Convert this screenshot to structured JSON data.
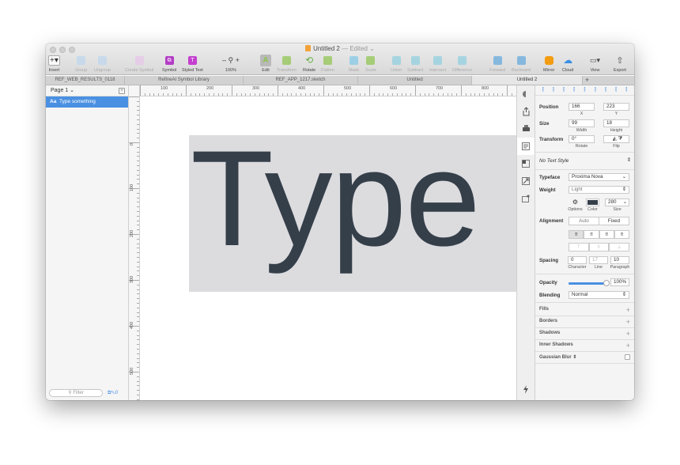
{
  "window": {
    "title": "Untitled 2",
    "title_suffix": "— Edited",
    "doc_icon": "sketch-doc-icon"
  },
  "toolbar": [
    {
      "id": "insert",
      "label": "Insert",
      "icon": "plus-icon",
      "dim": false
    },
    {
      "id": "group",
      "label": "Group",
      "icon": "group-icon",
      "dim": true
    },
    {
      "id": "ungroup",
      "label": "Ungroup",
      "icon": "ungroup-icon",
      "dim": true
    },
    {
      "id": "create-symbol",
      "label": "Create Symbol",
      "icon": "create-symbol-icon",
      "dim": true
    },
    {
      "id": "symbol",
      "label": "Symbol",
      "icon": "symbol-icon",
      "dim": false
    },
    {
      "id": "styled-text",
      "label": "Styled Text",
      "icon": "styled-text-icon",
      "dim": false
    },
    {
      "id": "zoom",
      "label": "100%",
      "icon": "zoom-icon",
      "dim": false
    },
    {
      "id": "edit",
      "label": "Edit",
      "icon": "edit-text-icon",
      "dim": false
    },
    {
      "id": "transform",
      "label": "Transform",
      "icon": "transform-icon",
      "dim": true
    },
    {
      "id": "rotate",
      "label": "Rotate",
      "icon": "rotate-icon",
      "dim": false
    },
    {
      "id": "flatten",
      "label": "Flatten",
      "icon": "flatten-icon",
      "dim": true
    },
    {
      "id": "mask",
      "label": "Mask",
      "icon": "mask-icon",
      "dim": true
    },
    {
      "id": "scale",
      "label": "Scale",
      "icon": "scale-icon",
      "dim": true
    },
    {
      "id": "union",
      "label": "Union",
      "icon": "union-icon",
      "dim": true
    },
    {
      "id": "subtract",
      "label": "Subtract",
      "icon": "subtract-icon",
      "dim": true
    },
    {
      "id": "intersect",
      "label": "Intersect",
      "icon": "intersect-icon",
      "dim": true
    },
    {
      "id": "difference",
      "label": "Difference",
      "icon": "difference-icon",
      "dim": true
    },
    {
      "id": "forward",
      "label": "Forward",
      "icon": "forward-icon",
      "dim": true
    },
    {
      "id": "backward",
      "label": "Backward",
      "icon": "backward-icon",
      "dim": true
    },
    {
      "id": "mirror",
      "label": "Mirror",
      "icon": "mirror-icon",
      "dim": false
    },
    {
      "id": "cloud",
      "label": "Cloud",
      "icon": "cloud-icon",
      "dim": false
    },
    {
      "id": "view",
      "label": "View",
      "icon": "view-icon",
      "dim": false
    },
    {
      "id": "export",
      "label": "Export",
      "icon": "export-icon",
      "dim": false
    }
  ],
  "tabs": [
    {
      "label": "REF_WEB_RESULTS_0118",
      "active": false
    },
    {
      "label": "RefineAI Symbol Library",
      "active": false
    },
    {
      "label": "REF_APP_1217.sketch",
      "active": false
    },
    {
      "label": "Untitled",
      "active": false
    },
    {
      "label": "Untitled 2",
      "active": true
    }
  ],
  "layers": {
    "page_label": "Page 1",
    "layer_prefix": "Aa",
    "layer_name": "Type something",
    "filter_placeholder": "Filter",
    "filter_count": "0"
  },
  "rulers": {
    "h": [
      "100",
      "200",
      "300",
      "400",
      "500",
      "600",
      "700",
      "800"
    ],
    "v": [
      "0",
      "100",
      "200",
      "300",
      "400",
      "500"
    ]
  },
  "canvas": {
    "text": "Type s"
  },
  "inspector": {
    "position_label": "Position",
    "x": "166",
    "x_label": "X",
    "y": "223",
    "y_label": "Y",
    "size_label": "Size",
    "width": "99",
    "width_label": "Width",
    "height": "18",
    "height_label": "Height",
    "transform_label": "Transform",
    "rotate": "0°",
    "rotate_label": "Rotate",
    "flip_label": "Flip",
    "text_style": "No Text Style",
    "typeface_label": "Typeface",
    "typeface": "Proxima Nova",
    "weight_label": "Weight",
    "weight": "Light",
    "options_label": "Options",
    "color_label": "Color",
    "font_size": "280",
    "size_sub": "Size",
    "text_color": "#353f4a",
    "alignment_label": "Alignment",
    "auto": "Auto",
    "fixed": "Fixed",
    "spacing_label": "Spacing",
    "character": "0",
    "character_label": "Character",
    "line": "17",
    "line_label": "Line",
    "paragraph": "10",
    "paragraph_label": "Paragraph",
    "opacity_label": "Opacity",
    "opacity": "100%",
    "opacity_fraction": 1.0,
    "blending_label": "Blending",
    "blending": "Normal",
    "sections": [
      "Fills",
      "Borders",
      "Shadows",
      "Inner Shadows",
      "Gaussian Blur"
    ]
  }
}
